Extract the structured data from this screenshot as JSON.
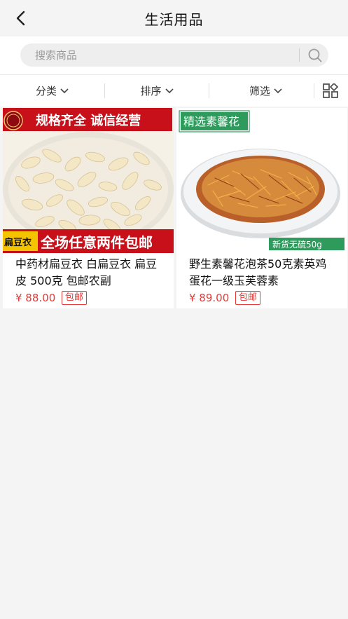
{
  "header": {
    "title": "生活用品"
  },
  "search": {
    "placeholder": "搜索商品",
    "value": ""
  },
  "filters": [
    {
      "label": "分类"
    },
    {
      "label": "排序"
    },
    {
      "label": "筛选"
    }
  ],
  "products": [
    {
      "name": "中药材扁豆衣 白扁豆衣 扁豆皮 500克 包邮农副",
      "price": "¥ 88.00",
      "tag": "包邮",
      "image": {
        "banner_top": "规格齐全 诚信经营",
        "seal": "扁豆衣",
        "label_left": "扁豆衣",
        "banner_bottom": "全场任意两件包邮"
      }
    },
    {
      "name": "野生素馨花泡茶50克素英鸡蛋花一级玉芙蓉素",
      "price": "¥ 89.00",
      "tag": "包邮",
      "image": {
        "label_top": "精选素馨花",
        "label_bottom": "新货无硫50g"
      }
    }
  ],
  "colors": {
    "accent": "#e53935",
    "banner_red": "#c8101a",
    "green_label": "#2e9b5c"
  }
}
